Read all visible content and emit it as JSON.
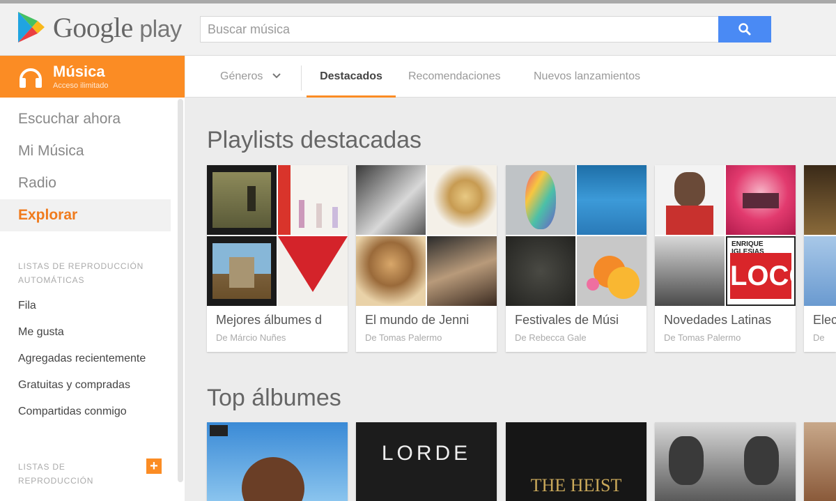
{
  "header": {
    "logo_google": "Google",
    "logo_play": "play",
    "search_placeholder": "Buscar música"
  },
  "brand": {
    "title": "Música",
    "subtitle": "Acceso ilimitado",
    "color": "#fb8c24"
  },
  "sidebar": {
    "nav": [
      {
        "label": "Escuchar ahora",
        "active": false
      },
      {
        "label": "Mi Música",
        "active": false
      },
      {
        "label": "Radio",
        "active": false
      },
      {
        "label": "Explorar",
        "active": true
      }
    ],
    "auto_head": "LISTAS DE REPRODUCCIÓN AUTOMÁTICAS",
    "auto_items": [
      "Fila",
      "Me gusta",
      "Agregadas recientemente",
      "Gratuitas y compradas",
      "Compartidas conmigo"
    ],
    "playlists_head": "LISTAS DE REPRODUCCIÓN",
    "add_label": "+"
  },
  "tabs": {
    "genres": "Géneros",
    "items": [
      "Destacados",
      "Recomendaciones",
      "Nuevos lanzamientos"
    ],
    "active": "Destacados"
  },
  "sections": {
    "featured_title": "Playlists destacadas",
    "top_title": "Top álbumes"
  },
  "playlists": [
    {
      "title": "Mejores álbumes d",
      "author": "De Márcio Nuñes"
    },
    {
      "title": "El mundo de Jenni",
      "author": "De Tomas Palermo"
    },
    {
      "title": "Festivales de Músi",
      "author": "De Rebecca Gale"
    },
    {
      "title": "Novedades Latinas",
      "author": "De Tomas Palermo"
    },
    {
      "title": "Elec",
      "author": "De"
    }
  ],
  "albums": [
    {
      "text": ""
    },
    {
      "text": "LORDE"
    },
    {
      "text": "THE HEIST"
    },
    {
      "text": ""
    },
    {
      "text": ""
    }
  ],
  "cover_text": {
    "loco_artist": "ENRIQUE IGLESIAS",
    "loco": "LOCO"
  },
  "icons": {
    "search": "search-icon",
    "headphones": "headphones-icon",
    "chevron": "chevron-down-icon",
    "logo": "play-triangle-icon"
  }
}
